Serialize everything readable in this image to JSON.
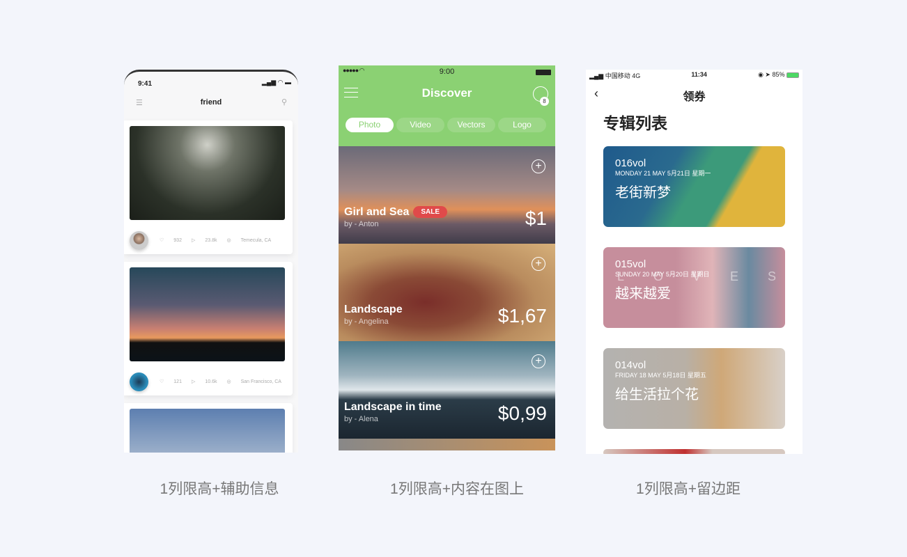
{
  "captions": [
    "1列限高+辅助信息",
    "1列限高+内容在图上",
    "1列限高+留边距"
  ],
  "phone1": {
    "time": "9:41",
    "status_icons": "signal wifi battery",
    "title": "friend",
    "menu_icon": "menu-icon",
    "search_icon": "search-icon",
    "posts": [
      {
        "likes": "932",
        "views": "23.8k",
        "location": "Temecula, CA"
      },
      {
        "likes": "121",
        "views": "10.6k",
        "location": "San Francisco, CA"
      }
    ]
  },
  "phone2": {
    "time": "9:00",
    "title": "Discover",
    "cart_count": "8",
    "accent": "#8bd173",
    "tabs": [
      "Photo",
      "Video",
      "Vectors",
      "Logo"
    ],
    "items": [
      {
        "name": "Girl and Sea",
        "badge": "SALE",
        "by": "by - Anton",
        "price": "$1"
      },
      {
        "name": "Landscape",
        "by": "by - Angelina",
        "price": "$1,67"
      },
      {
        "name": "Landscape in time",
        "by": "by - Alena",
        "price": "$0,99"
      }
    ]
  },
  "phone3": {
    "carrier": "中国移动  4G",
    "time": "11:34",
    "battery": "85%",
    "title": "领券",
    "heading": "专辑列表",
    "albums": [
      {
        "vol": "016vol",
        "date": "MONDAY 21 MAY 5月21日 星期一",
        "name": "老街新梦"
      },
      {
        "vol": "015vol",
        "date": "SUNDAY 20 MAY 5月20日 星期日",
        "name": "越来越爱",
        "deco": "LOVES"
      },
      {
        "vol": "014vol",
        "date": "FRIDAY 18 MAY 5月18日 星期五",
        "name": "给生活拉个花"
      }
    ]
  }
}
